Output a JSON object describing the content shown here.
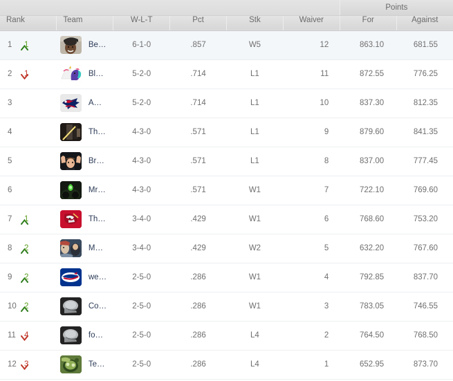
{
  "table": {
    "group_header": {
      "points_label": "Points"
    },
    "columns": {
      "rank": "Rank",
      "team": "Team",
      "wlt": "W-L-T",
      "pct": "Pct",
      "stk": "Stk",
      "waiver": "Waiver",
      "points_for": "For",
      "points_against": "Against"
    },
    "colors": {
      "header_bg": "#dcdcdc",
      "header_text": "#6b6b6b",
      "row_highlight": "#f4f7fa",
      "team_link": "#2c3b57",
      "move_up": "#5a9e20",
      "move_down": "#c0392b",
      "body_text": "#6f6f6f"
    },
    "rows": [
      {
        "rank": "1",
        "move_direction": "up",
        "move_amount": "1",
        "team": "Beef Mo' Twenny Fo'",
        "avatar": "photo-person-dark-cap-icon",
        "wlt": "6-1-0",
        "pct": ".857",
        "stk": "W5",
        "waiver": "12",
        "points_for": "863.10",
        "points_against": "681.55",
        "highlighted": true
      },
      {
        "rank": "2",
        "move_direction": "down",
        "move_amount": "1",
        "team": "Blue Drees",
        "avatar": "pony-unicorn-icon",
        "wlt": "5-2-0",
        "pct": ".714",
        "stk": "L1",
        "waiver": "11",
        "points_for": "872.55",
        "points_against": "776.25",
        "highlighted": false
      },
      {
        "rank": "3",
        "move_direction": "none",
        "move_amount": "",
        "team": "AMurray AMurray by Bangladesh",
        "avatar": "patriots-logo-icon",
        "wlt": "5-2-0",
        "pct": ".714",
        "stk": "L1",
        "waiver": "10",
        "points_for": "837.30",
        "points_against": "812.35",
        "highlighted": false
      },
      {
        "rank": "4",
        "move_direction": "none",
        "move_amount": "",
        "team": "The Shwartz is with me",
        "avatar": "photo-lightsaber-dark-icon",
        "wlt": "4-3-0",
        "pct": ".571",
        "stk": "L1",
        "waiver": "9",
        "points_for": "879.60",
        "points_against": "841.35",
        "highlighted": false
      },
      {
        "rank": "5",
        "move_direction": "none",
        "move_amount": "",
        "team": "BradyLivesMatter",
        "avatar": "photo-face-hands-icon",
        "wlt": "4-3-0",
        "pct": ".571",
        "stk": "L1",
        "waiver": "8",
        "points_for": "837.00",
        "points_against": "777.45",
        "highlighted": false
      },
      {
        "rank": "6",
        "move_direction": "none",
        "move_amount": "",
        "team": "Mr Toad's Wild Ride",
        "avatar": "photo-green-dark-icon",
        "wlt": "4-3-0",
        "pct": ".571",
        "stk": "W1",
        "waiver": "7",
        "points_for": "722.10",
        "points_against": "769.60",
        "highlighted": false
      },
      {
        "rank": "7",
        "move_direction": "up",
        "move_amount": "1",
        "team": "The Winston Unfiltereds",
        "avatar": "buccaneers-logo-icon",
        "wlt": "3-4-0",
        "pct": ".429",
        "stk": "W1",
        "waiver": "6",
        "points_for": "768.60",
        "points_against": "753.20",
        "highlighted": false
      },
      {
        "rank": "8",
        "move_direction": "up",
        "move_amount": "2",
        "team": "More Bell Cows",
        "avatar": "photo-crowd-icon",
        "wlt": "3-4-0",
        "pct": ".429",
        "stk": "W2",
        "waiver": "5",
        "points_for": "632.20",
        "points_against": "767.60",
        "highlighted": false
      },
      {
        "rank": "9",
        "move_direction": "up",
        "move_amount": "2",
        "team": "we're going hamburger buns",
        "avatar": "bills-logo-icon",
        "wlt": "2-5-0",
        "pct": ".286",
        "stk": "W1",
        "waiver": "4",
        "points_for": "792.85",
        "points_against": "837.70",
        "highlighted": false
      },
      {
        "rank": "10",
        "move_direction": "up",
        "move_amount": "2",
        "team": "Colostomy Bags",
        "avatar": "helmet-grey-icon",
        "wlt": "2-5-0",
        "pct": ".286",
        "stk": "W1",
        "waiver": "3",
        "points_for": "783.05",
        "points_against": "746.55",
        "highlighted": false
      },
      {
        "rank": "11",
        "move_direction": "down",
        "move_amount": "4",
        "team": "football fantasy fuck",
        "avatar": "helmet-grey-icon",
        "wlt": "2-5-0",
        "pct": ".286",
        "stk": "L4",
        "waiver": "2",
        "points_for": "764.50",
        "points_against": "768.50",
        "highlighted": false
      },
      {
        "rank": "12",
        "move_direction": "down",
        "move_amount": "3",
        "team": "Teenage Mutant Ninja Bortles",
        "avatar": "turtle-green-icon",
        "wlt": "2-5-0",
        "pct": ".286",
        "stk": "L4",
        "waiver": "1",
        "points_for": "652.95",
        "points_against": "873.70",
        "highlighted": false
      }
    ]
  }
}
